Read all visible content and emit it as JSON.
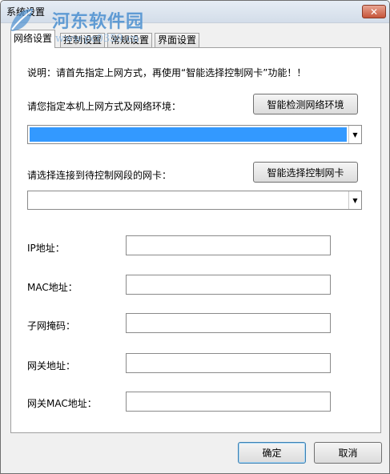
{
  "window": {
    "title": "系统设置",
    "close_glyph": "✕"
  },
  "watermark": {
    "site_name": "河东软件园",
    "url": "www.pc0359.cn",
    "logo_icon": "leaf-logo-icon"
  },
  "tabs": [
    {
      "label": "网络设置",
      "active": true
    },
    {
      "label": "控制设置",
      "active": false
    },
    {
      "label": "常规设置",
      "active": false
    },
    {
      "label": "界面设置",
      "active": false
    }
  ],
  "network": {
    "note": "说明：请首先指定上网方式，再使用“智能选择控制网卡”功能！！",
    "mode_label": "请您指定本机上网方式及网络环境：",
    "detect_button": "智能检测网络环境",
    "nic_label": "请选择连接到待控制网段的网卡：",
    "select_nic_button": "智能选择控制网卡",
    "fields": [
      {
        "label": "IP地址：",
        "value": ""
      },
      {
        "label": "MAC地址：",
        "value": ""
      },
      {
        "label": "子网掩码：",
        "value": ""
      },
      {
        "label": "网关地址：",
        "value": ""
      },
      {
        "label": "网关MAC地址：",
        "value": ""
      }
    ]
  },
  "footer": {
    "ok_label": "确定",
    "cancel_label": "取消"
  },
  "colors": {
    "selection": "#3399ff",
    "close": "#c6553a",
    "watermark": "#4a8fd0"
  }
}
